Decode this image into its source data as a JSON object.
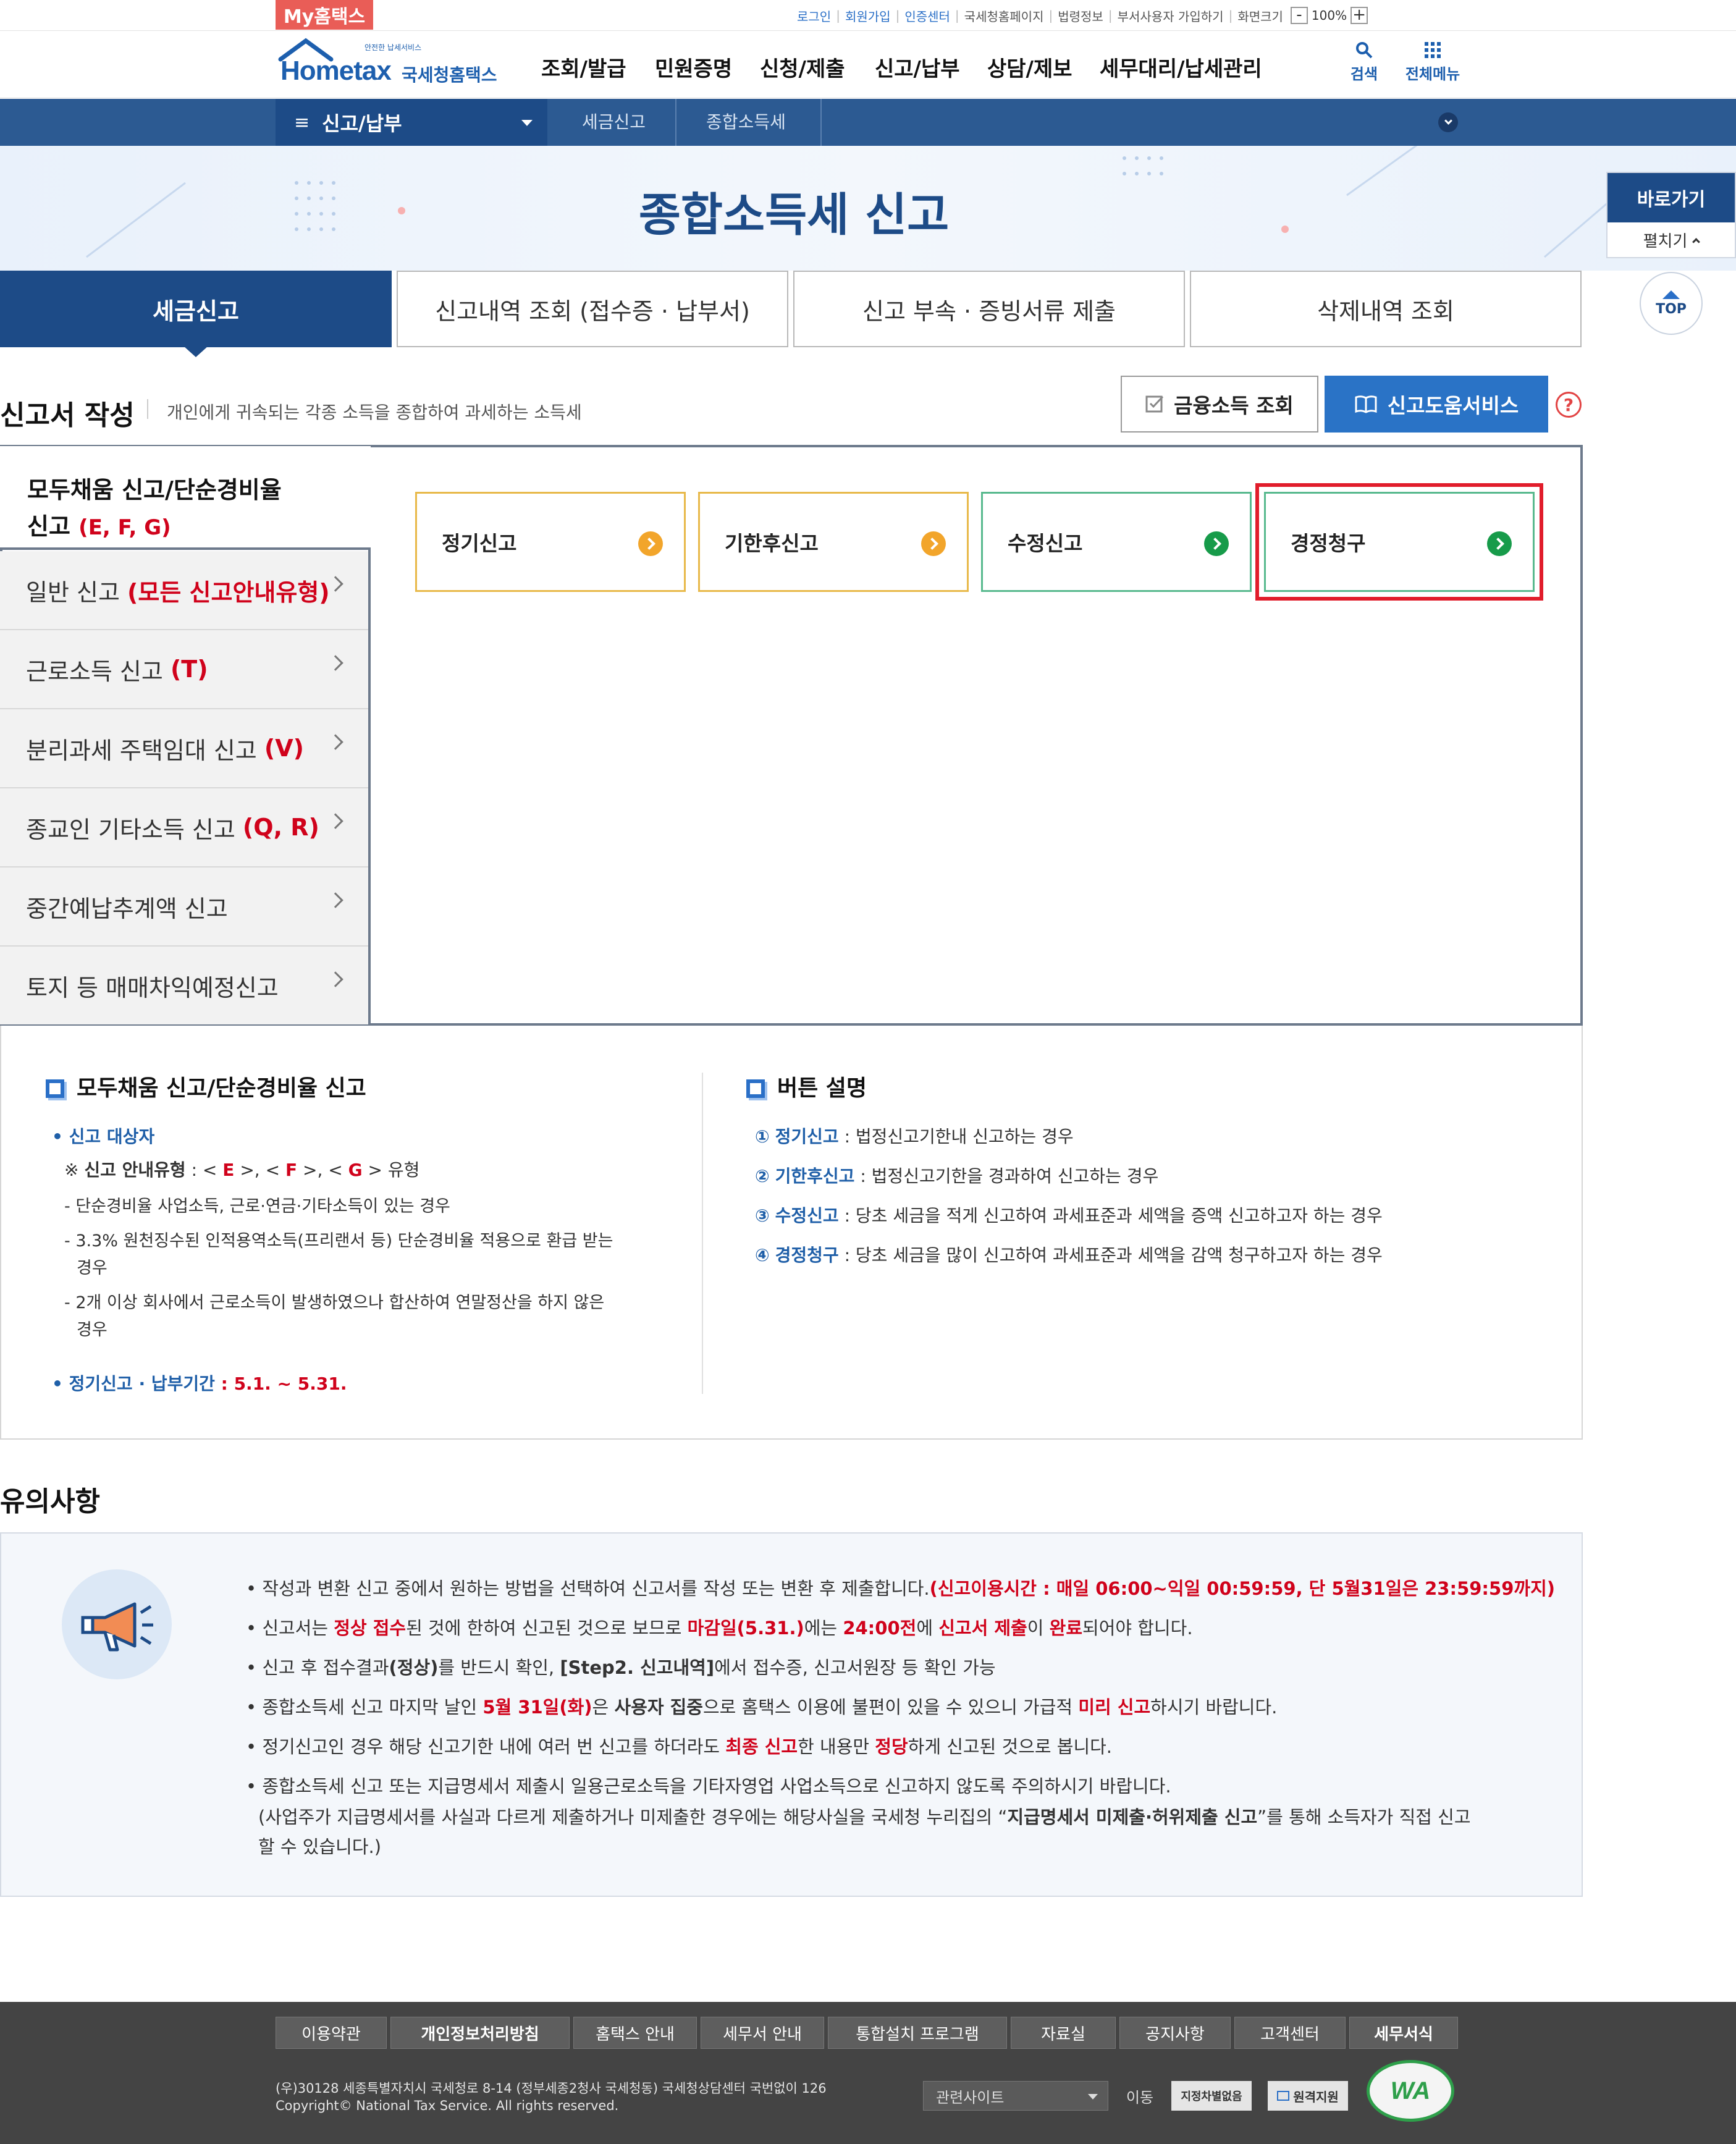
{
  "util": {
    "my_hometax": "My홈택스",
    "links": [
      "로그인",
      "회원가입",
      "인증센터",
      "국세청홈페이지",
      "법령정보",
      "부서사용자 가입하기",
      "화면크기"
    ],
    "zoom_minus": "-",
    "zoom_level": "100%",
    "zoom_plus": "+"
  },
  "header": {
    "logo_tagline": "안전한 납세서비스",
    "logo_main": "Hometax",
    "logo_sub": "국세청홈택스",
    "gnb": [
      "조회/발급",
      "민원증명",
      "신청/제출",
      "신고/납부",
      "상담/제보",
      "세무대리/납세관리"
    ],
    "search_label": "검색",
    "allmenu_label": "전체메뉴"
  },
  "location": {
    "menu": "신고/납부",
    "crumb1": "세금신고",
    "crumb2": "종합소득세"
  },
  "quick": {
    "title": "바로가기",
    "expand": "펼치기",
    "top": "TOP"
  },
  "page": {
    "title": "종합소득세 신고"
  },
  "tabs": [
    "세금신고",
    "신고내역 조회 (접수증 · 납부서)",
    "신고 부속 · 증빙서류 제출",
    "삭제내역 조회"
  ],
  "section": {
    "title": "신고서 작성",
    "desc": "개인에게 귀속되는 각종 소득을 종합하여 과세하는 소득세",
    "btn_finance": "금융소득 조회",
    "btn_help": "신고도움서비스",
    "help_mark": "?"
  },
  "side": {
    "active_line1": "모두채움 신고/단순경비율",
    "active_line2": "신고",
    "active_codes": "(E, F, G)",
    "items": [
      {
        "label": "일반 신고",
        "code": "(모든 신고안내유형)"
      },
      {
        "label": "근로소득 신고",
        "code": "(T)"
      },
      {
        "label": "분리과세 주택임대 신고",
        "code": "(V)"
      },
      {
        "label": "종교인 기타소득 신고",
        "code": "(Q, R)"
      },
      {
        "label": "중간예납추계액 신고",
        "code": ""
      },
      {
        "label": "토지 등 매매차익예정신고",
        "code": ""
      }
    ]
  },
  "cards": [
    "정기신고",
    "기한후신고",
    "수정신고",
    "경정청구"
  ],
  "info_left": {
    "heading": "모두채움 신고/단순경비율 신고",
    "target_label": "신고 대상자",
    "type_prefix": "※",
    "type_label": "신고 안내유형",
    "type_lt1": " : < ",
    "type_e": "E",
    "type_mid1": " >, < ",
    "type_f": "F",
    "type_mid2": " >, < ",
    "type_g": "G",
    "type_end": " > 유형",
    "b1": "- 단순경비율 사업소득, 근로·연금·기타소득이 있는 경우",
    "b2a": "- 3.3% 원천징수된 인적용역소득(프리랜서 등) 단순경비율 적용으로 환급 받는",
    "b2b": "경우",
    "b3a": "- 2개 이상 회사에서 근로소득이 발생하였으나 합산하여 연말정산을 하지 않은",
    "b3b": "경우",
    "period_label": "정기신고 · 납부기간",
    "period_value": " : 5.1. ~ 5.31."
  },
  "info_right": {
    "heading": "버튼 설명",
    "items": [
      {
        "num": "①",
        "name": "정기신고",
        "desc": " : 법정신고기한내 신고하는 경우"
      },
      {
        "num": "②",
        "name": "기한후신고",
        "desc": " : 법정신고기한을 경과하여 신고하는 경우"
      },
      {
        "num": "③",
        "name": "수정신고",
        "desc": " : 당초 세금을 적게 신고하여 과세표준과 세액을 증액 신고하고자 하는 경우"
      },
      {
        "num": "④",
        "name": "경정청구",
        "desc": " : 당초 세금을 많이 신고하여 과세표준과 세액을 감액 청구하고자 하는 경우"
      }
    ]
  },
  "notice": {
    "title": "유의사항",
    "l1a": "• 작성과 변환 신고 중에서 원하는 방법을 선택하여 신고서를 작성 또는 변환 후 제출합니다.",
    "l1b": "(신고이용시간 : 매일 06:00~익일 00:59:59, 단 5월31일은 23:59:59까지)",
    "l2a": "• 신고서는 ",
    "l2b": "정상 접수",
    "l2c": "된 것에 한하여 신고된 것으로 보므로 ",
    "l2d": "마감일(5.31.)",
    "l2e": "에는 ",
    "l2f": "24:00전",
    "l2g": "에 ",
    "l2h": "신고서 제출",
    "l2i": "이 ",
    "l2j": "완료",
    "l2k": "되어야 합니다.",
    "l3a": "• 신고 후 접수결과",
    "l3b": "(정상)",
    "l3c": "를 반드시 확인, ",
    "l3d": "[Step2. 신고내역]",
    "l3e": "에서 접수증, 신고서원장 등 확인 가능",
    "l4a": "• 종합소득세 신고 마지막 날인 ",
    "l4b": "5월 31일(화)",
    "l4c": "은 ",
    "l4d": "사용자 집중",
    "l4e": "으로 홈택스 이용에 불편이 있을 수 있으니 가급적 ",
    "l4f": "미리 신고",
    "l4g": "하시기 바랍니다.",
    "l5a": "• 정기신고인 경우 해당 신고기한 내에 여러 번 신고를 하더라도 ",
    "l5b": "최종 신고",
    "l5c": "한 내용만 ",
    "l5d": "정당",
    "l5e": "하게 신고된 것으로 봅니다.",
    "l6": "• 종합소득세 신고 또는 지급명세서 제출시 일용근로소득을 기타자영업 사업소득으로 신고하지 않도록 주의하시기 바랍니다.",
    "l7a": "(사업주가 지급명세서를 사실과 다르게 제출하거나 미제출한 경우에는 해당사실을 국세청 누리집의 “",
    "l7b": "지급명세서 미제출·허위제출 신고",
    "l7c": "”를 통해 소득자가 직접 신고",
    "l8": "할 수 있습니다.)"
  },
  "footer": {
    "tabs": [
      "이용약관",
      "개인정보처리방침",
      "홈택스 안내",
      "세무서 안내",
      "통합설치 프로그램",
      "자료실",
      "공지사항",
      "고객센터",
      "세무서식"
    ],
    "address": "(우)30128 세종특별자치시 국세청로 8-14 (정부세종2청사 국세청동) 국세청상담센터 국번없이 126",
    "copyright": "Copyright© National Tax Service. All rights reserved.",
    "related_site": "관련사이트",
    "move": "이동",
    "badge1": "지정차별없음",
    "badge2": "원격지원",
    "wa": "WA"
  },
  "colors": {
    "brand_blue": "#1d4b87",
    "accent_red": "#d0021b",
    "help_blue": "#2a73c6",
    "highlight_box": "#e11"
  }
}
